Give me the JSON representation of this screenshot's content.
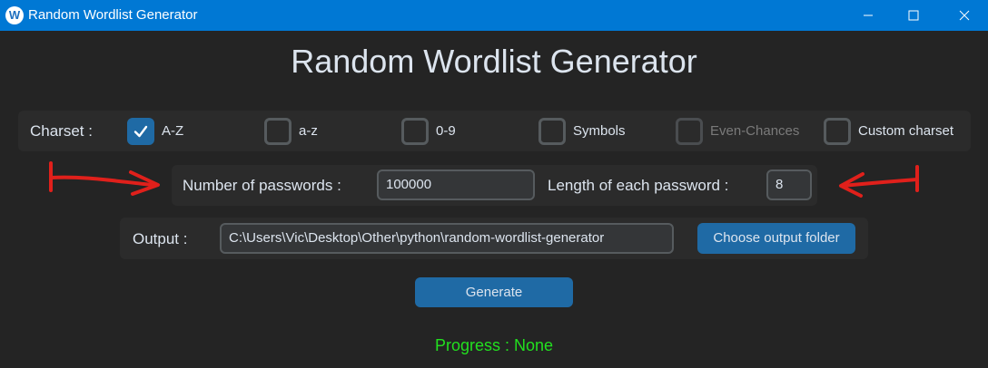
{
  "window": {
    "title": "Random Wordlist Generator",
    "icon": "w-logo-icon",
    "controls": [
      "minimize-icon",
      "maximize-icon",
      "close-icon"
    ]
  },
  "heading": "Random Wordlist Generator",
  "charset": {
    "label": "Charset :",
    "options": [
      {
        "label": "A-Z",
        "checked": true,
        "disabled": false
      },
      {
        "label": "a-z",
        "checked": false,
        "disabled": false
      },
      {
        "label": "0-9",
        "checked": false,
        "disabled": false
      },
      {
        "label": "Symbols",
        "checked": false,
        "disabled": false
      },
      {
        "label": "Even-Chances",
        "checked": false,
        "disabled": true
      },
      {
        "label": "Custom charset",
        "checked": false,
        "disabled": false
      }
    ]
  },
  "params": {
    "count_label": "Number of passwords :",
    "count_value": "100000",
    "length_label": "Length of each password :",
    "length_value": "8"
  },
  "output": {
    "label": "Output :",
    "path": "C:\\Users\\Vic\\Desktop\\Other\\python\\random-wordlist-generator",
    "choose_button": "Choose output folder"
  },
  "generate_button": "Generate",
  "progress_text": "Progress : None",
  "colors": {
    "titlebar": "#0078d4",
    "background": "#242424",
    "frame": "#2b2b2b",
    "accent": "#1f6aa5",
    "progress": "#22e01f",
    "annotation_arrow": "#e0201b"
  }
}
